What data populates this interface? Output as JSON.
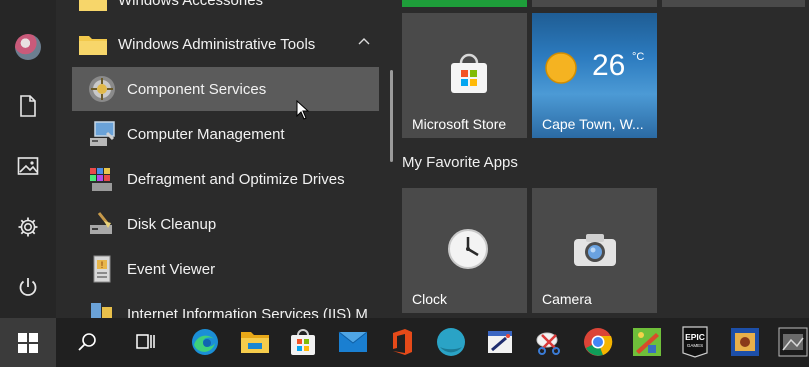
{
  "start_menu": {
    "rail": {
      "items": [
        {
          "name": "user-avatar",
          "icon": "avatar"
        },
        {
          "name": "documents",
          "icon": "document-icon"
        },
        {
          "name": "pictures",
          "icon": "image-icon"
        },
        {
          "name": "settings",
          "icon": "gear-icon"
        },
        {
          "name": "power",
          "icon": "power-icon"
        }
      ]
    },
    "app_list": {
      "partial_top_label": "Windows Accessories",
      "folder_label": "Windows Administrative Tools",
      "items": [
        {
          "label": "Component Services",
          "icon": "component-services-icon"
        },
        {
          "label": "Computer Management",
          "icon": "computer-management-icon"
        },
        {
          "label": "Defragment and Optimize Drives",
          "icon": "defragment-icon"
        },
        {
          "label": "Disk Cleanup",
          "icon": "disk-cleanup-icon"
        },
        {
          "label": "Event Viewer",
          "icon": "event-viewer-icon"
        },
        {
          "label": "Internet Information Services (IIS) M",
          "icon": "iis-icon"
        }
      ]
    },
    "tiles": {
      "store_label": "Microsoft Store",
      "weather_temp": "26",
      "weather_unit": "°C",
      "weather_city": "Cape Town, W...",
      "group_title": "My Favorite Apps",
      "clock_label": "Clock",
      "camera_label": "Camera"
    }
  },
  "taskbar": {
    "items": [
      "start-button",
      "search-icon",
      "task-view-icon",
      "edge-icon",
      "file-explorer-icon",
      "microsoft-store-icon",
      "mail-icon",
      "office-icon",
      "teal-circle-app-icon",
      "paint-icon",
      "snip-icon",
      "chrome-icon",
      "game-app-icon",
      "epic-games-icon",
      "blue-game-icon",
      "dark-game-icon"
    ],
    "epic_text_top": "EPIC",
    "epic_text_bottom": "GAMES"
  },
  "colors": {
    "menu_bg": "#2b2b2b",
    "tile_bg": "#4a4a4a",
    "hover_bg": "#5b5b5b",
    "taskbar_bg": "#202020",
    "accent_green": "#1e9e3a"
  }
}
